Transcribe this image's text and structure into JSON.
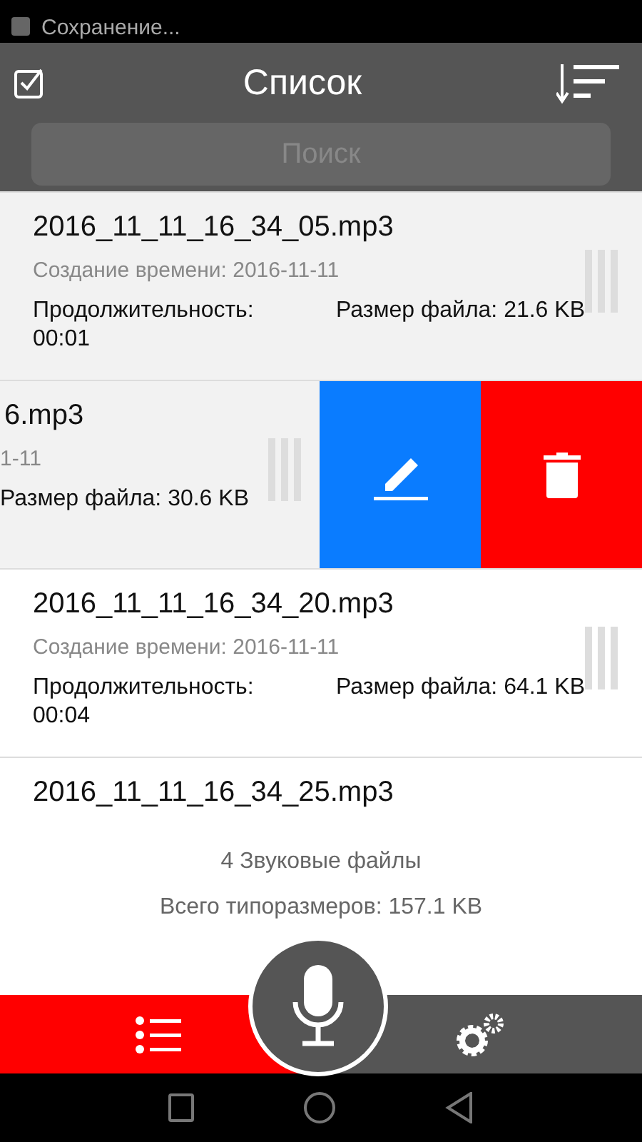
{
  "status_bar": {
    "notification": "Сохранение..."
  },
  "header": {
    "title": "Список",
    "search": {
      "placeholder": "Поиск"
    }
  },
  "recordings": [
    {
      "kind": "normal",
      "highlighted": true,
      "name": "2016_11_11_16_34_05.mp3",
      "created": "Создание времени: 2016-11-11",
      "duration_label": "Продолжительность:",
      "duration": "00:01",
      "size": "Размер файла: 21.6 KB"
    },
    {
      "kind": "swiped",
      "highlighted": true,
      "name": "6.mp3",
      "created": "1-11",
      "size": "Размер файла: 30.6 KB"
    },
    {
      "kind": "normal",
      "highlighted": false,
      "name": "2016_11_11_16_34_20.mp3",
      "created": "Создание времени: 2016-11-11",
      "duration_label": "Продолжительность:",
      "duration": "00:04",
      "size": "Размер файла: 64.1 KB"
    },
    {
      "kind": "name_only",
      "highlighted": false,
      "name": "2016_11_11_16_34_25.mp3"
    }
  ],
  "summary": {
    "count": "4 Звуковые файлы",
    "total": "Всего типоразмеров: 157.1 KB"
  },
  "bottom_tabs": [
    {
      "kind": "list",
      "selected": true
    },
    {
      "kind": "settings",
      "selected": false
    }
  ]
}
